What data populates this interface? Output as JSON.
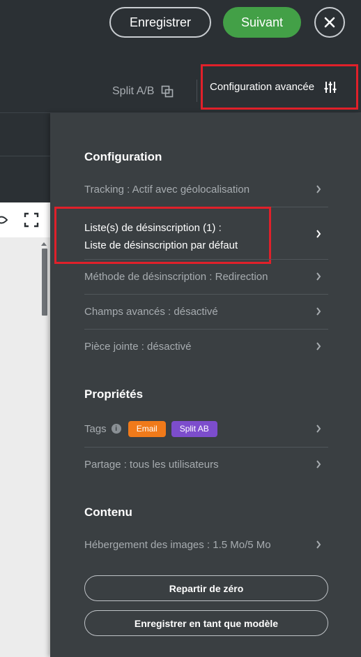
{
  "header": {
    "save_label": "Enregistrer",
    "next_label": "Suivant",
    "next_color": "#43a047"
  },
  "toolbar": {
    "split_label": "Split A/B",
    "advanced_label": "Configuration avancée"
  },
  "panel": {
    "configuration": {
      "title": "Configuration",
      "tracking": "Tracking : Actif avec géolocalisation",
      "unsubscribe_line1": "Liste(s) de désinscription (1) :",
      "unsubscribe_line2": "Liste de désinscription par défaut",
      "unsubscribe_method": "Méthode de désinscription : Redirection",
      "advanced_fields": "Champs avancés : désactivé",
      "attachment": "Pièce jointe : désactivé"
    },
    "properties": {
      "title": "Propriétés",
      "tags_label": "Tags",
      "tags": [
        {
          "label": "Email",
          "color": "#f07a1a"
        },
        {
          "label": "Split AB",
          "color": "#7c4dcc"
        }
      ],
      "sharing": "Partage : tous les utilisateurs"
    },
    "content": {
      "title": "Contenu",
      "image_hosting": "Hébergement des images : 1.5 Mo/5 Mo"
    },
    "buttons": {
      "restart": "Repartir de zéro",
      "save_template": "Enregistrer en tant que modèle"
    }
  },
  "colors": {
    "highlight": "#e0202a",
    "panel_bg": "#3a3f42",
    "topbar_bg": "#2b3034"
  }
}
